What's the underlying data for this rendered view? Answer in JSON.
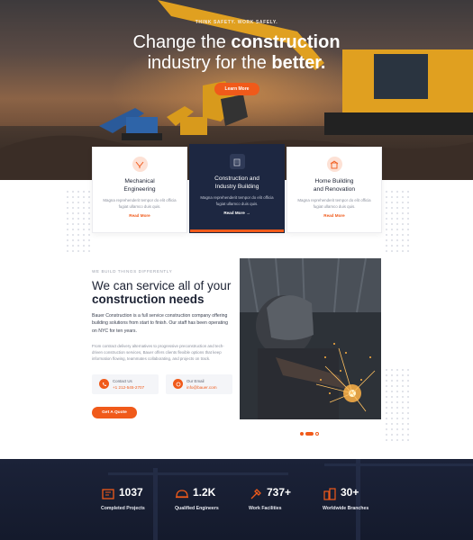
{
  "hero": {
    "tagline": "THINK SAFETY. WORK SAFELY.",
    "headline_line1_pre": "Change the ",
    "headline_line1_bold": "construction",
    "headline_line2_pre": "industry for the ",
    "headline_line2_bold": "better.",
    "cta": "Learn More"
  },
  "services": [
    {
      "title_l1": "Mechanical",
      "title_l2": "Engineering",
      "desc": "Magna reprehenderit tempor do elit officia fugiat ullamco duis quis.",
      "more": "Read More",
      "icon": "gear-tools-icon"
    },
    {
      "title_l1": "Construction and",
      "title_l2": "Industry Building",
      "desc": "Magna reprehenderit tempor do elit officia fugiat ullamco duis quis.",
      "more": "Read More",
      "icon": "building-icon"
    },
    {
      "title_l1": "Home Building",
      "title_l2": "and Renovation",
      "desc": "Magna reprehenderit tempor do elit officia fugiat ullamco duis quis.",
      "more": "Read More",
      "icon": "house-icon"
    }
  ],
  "about": {
    "kicker": "WE BUILD THINGS DIFFERENTLY",
    "heading_pre": "We can service all of your",
    "heading_bold": "construction needs",
    "para1": "Bauer Construction is a full service construction company offering building solutions from start to finish. Our staff has been operating on NYC for ten years.",
    "para2": "From contract delivery alternatives to progressive preconstruction and tech-driven construction services, Bauer offers clients flexible options that keep information flowing, teammates collaborating, and projects on track.",
    "contact_phone_label": "Contact Us",
    "contact_phone_value": "+1 212-545-2707",
    "contact_email_label": "Our Email",
    "contact_email_value": "info@bauer.com",
    "cta": "Get A Quote"
  },
  "stats": [
    {
      "number": "1037",
      "label": "Completed Projects",
      "icon": "blueprint-icon"
    },
    {
      "number": "1.2K",
      "label": "Qualified Engineers",
      "icon": "helmet-icon"
    },
    {
      "number": "737+",
      "label": "Work Facilities",
      "icon": "tools-icon"
    },
    {
      "number": "30+",
      "label": "Worldwide Branches",
      "icon": "buildings-icon"
    }
  ],
  "colors": {
    "accent": "#f05a1a",
    "navy": "#1d2741"
  }
}
